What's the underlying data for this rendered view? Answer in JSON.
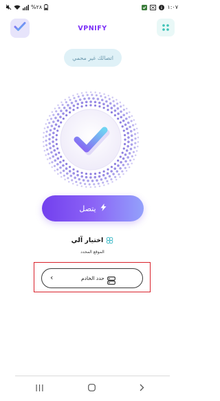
{
  "status_bar": {
    "left_text": "%٢٨",
    "time": "١:٠٧"
  },
  "header": {
    "title": "VPNIFY",
    "logo_icon": "check-logo-icon",
    "menu_icon": "grid-dots-icon"
  },
  "connection_status": "اتصالك غير محمي",
  "connect_button": {
    "label": "يتصل",
    "icon": "lightning-icon"
  },
  "location": {
    "auto_label": "اختيار آلي",
    "sub_label": "الموقع المحدد"
  },
  "server_selector": {
    "label": "حدد الخادم",
    "icon": "server-icon",
    "chevron": "‹"
  },
  "colors": {
    "brand": "#7b2ff7",
    "button_start": "#7340ee",
    "button_end": "#93a1fb",
    "pill_bg": "#dff1f7",
    "highlight": "#d9202a"
  }
}
